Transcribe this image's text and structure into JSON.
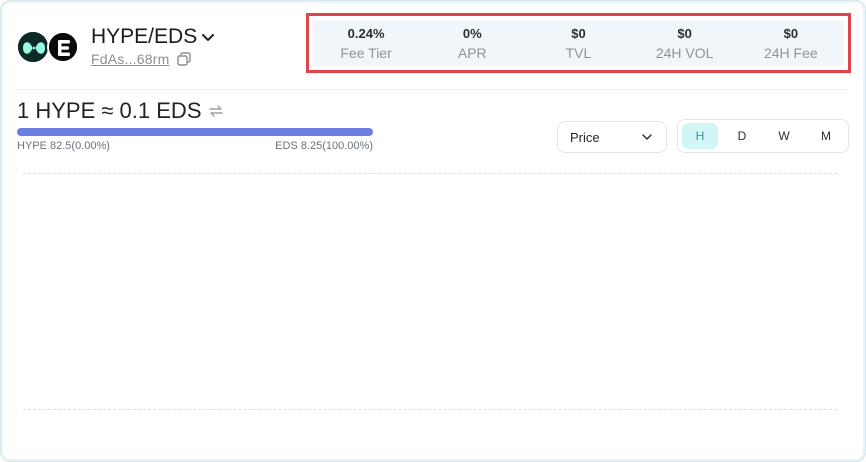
{
  "pair": {
    "name": "HYPE/EDS",
    "address": "FdAs...68rm",
    "token1_icon": "hyperliquid-logo-icon",
    "token2_icon": "eds-logo-icon"
  },
  "stats": [
    {
      "value": "0.24%",
      "label": "Fee Tier"
    },
    {
      "value": "0%",
      "label": "APR"
    },
    {
      "value": "$0",
      "label": "TVL"
    },
    {
      "value": "$0",
      "label": "24H VOL"
    },
    {
      "value": "$0",
      "label": "24H Fee"
    }
  ],
  "rate": {
    "text": "1 HYPE ≈ 0.1 EDS",
    "left_label": "HYPE 82.5(0.00%)",
    "right_label": "EDS 8.25(100.00%)"
  },
  "chart_type_select": {
    "value": "Price"
  },
  "timeframes": [
    {
      "label": "H",
      "active": true
    },
    {
      "label": "D",
      "active": false
    },
    {
      "label": "W",
      "active": false
    },
    {
      "label": "M",
      "active": false
    }
  ],
  "colors": {
    "highlight_border": "#e0434a",
    "ratio_bar": "#6b7fe0",
    "active_tab_bg": "#d2f6f6"
  }
}
